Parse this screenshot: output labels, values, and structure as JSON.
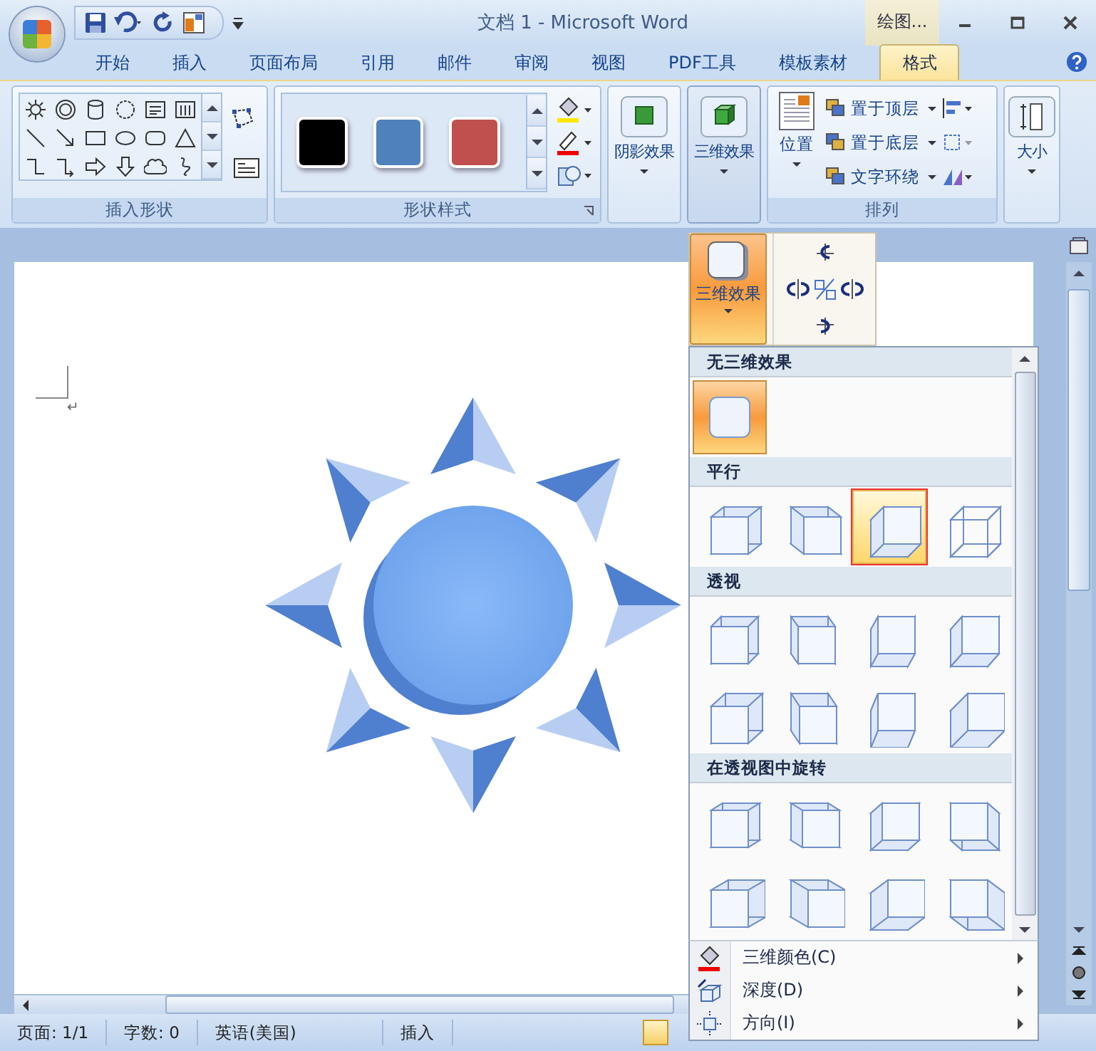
{
  "window": {
    "title": "文档 1 - Microsoft Word",
    "context_tab": "绘图..."
  },
  "tabs": [
    {
      "label": "开始",
      "selected": false
    },
    {
      "label": "插入",
      "selected": false
    },
    {
      "label": "页面布局",
      "selected": false
    },
    {
      "label": "引用",
      "selected": false
    },
    {
      "label": "邮件",
      "selected": false
    },
    {
      "label": "审阅",
      "selected": false
    },
    {
      "label": "视图",
      "selected": false
    },
    {
      "label": "PDF工具",
      "selected": false
    },
    {
      "label": "模板素材",
      "selected": false
    },
    {
      "label": "格式",
      "selected": true
    }
  ],
  "ribbon": {
    "insert_shapes": {
      "label": "插入形状"
    },
    "shape_styles": {
      "label": "形状样式",
      "swatches": [
        {
          "color": "#000000"
        },
        {
          "color": "#4f81bd"
        },
        {
          "color": "#c0504d"
        }
      ]
    },
    "shadow_effects": {
      "label": "阴影效果",
      "pressed": false
    },
    "effects_3d": {
      "label": "三维效果",
      "pressed": true
    },
    "arrange": {
      "label": "排列",
      "position": "位置",
      "commands": [
        "置于顶层",
        "置于底层",
        "文字环绕"
      ]
    },
    "size": {
      "label": "大小"
    }
  },
  "document": {
    "paragraph_mark": "↵"
  },
  "dropdown": {
    "button_label": "三维效果",
    "sections": [
      {
        "title": "无三维效果",
        "items": [
          {
            "selected": true,
            "highlighted": false
          }
        ]
      },
      {
        "title": "平行",
        "items": [
          {
            "selected": false,
            "highlighted": false
          },
          {
            "selected": false,
            "highlighted": false
          },
          {
            "selected": false,
            "highlighted": true
          },
          {
            "selected": false,
            "highlighted": false
          }
        ]
      },
      {
        "title": "透视",
        "items": [
          {
            "selected": false,
            "highlighted": false
          },
          {
            "selected": false,
            "highlighted": false
          },
          {
            "selected": false,
            "highlighted": false
          },
          {
            "selected": false,
            "highlighted": false
          },
          {
            "selected": false,
            "highlighted": false
          },
          {
            "selected": false,
            "highlighted": false
          },
          {
            "selected": false,
            "highlighted": false
          },
          {
            "selected": false,
            "highlighted": false
          }
        ]
      },
      {
        "title": "在透视图中旋转",
        "items": [
          {
            "selected": false,
            "highlighted": false
          },
          {
            "selected": false,
            "highlighted": false
          },
          {
            "selected": false,
            "highlighted": false
          },
          {
            "selected": false,
            "highlighted": false
          },
          {
            "selected": false,
            "highlighted": false
          },
          {
            "selected": false,
            "highlighted": false
          },
          {
            "selected": false,
            "highlighted": false
          },
          {
            "selected": false,
            "highlighted": false
          }
        ]
      }
    ],
    "menu": [
      {
        "label": "三维颜色(C)",
        "kind": "color"
      },
      {
        "label": "深度(D)",
        "kind": "depth"
      },
      {
        "label": "方向(I)",
        "kind": "direction"
      }
    ]
  },
  "status_bar": {
    "page": "页面: 1/1",
    "words": "字数: 0",
    "language": "英语(美国)",
    "mode": "插入"
  }
}
